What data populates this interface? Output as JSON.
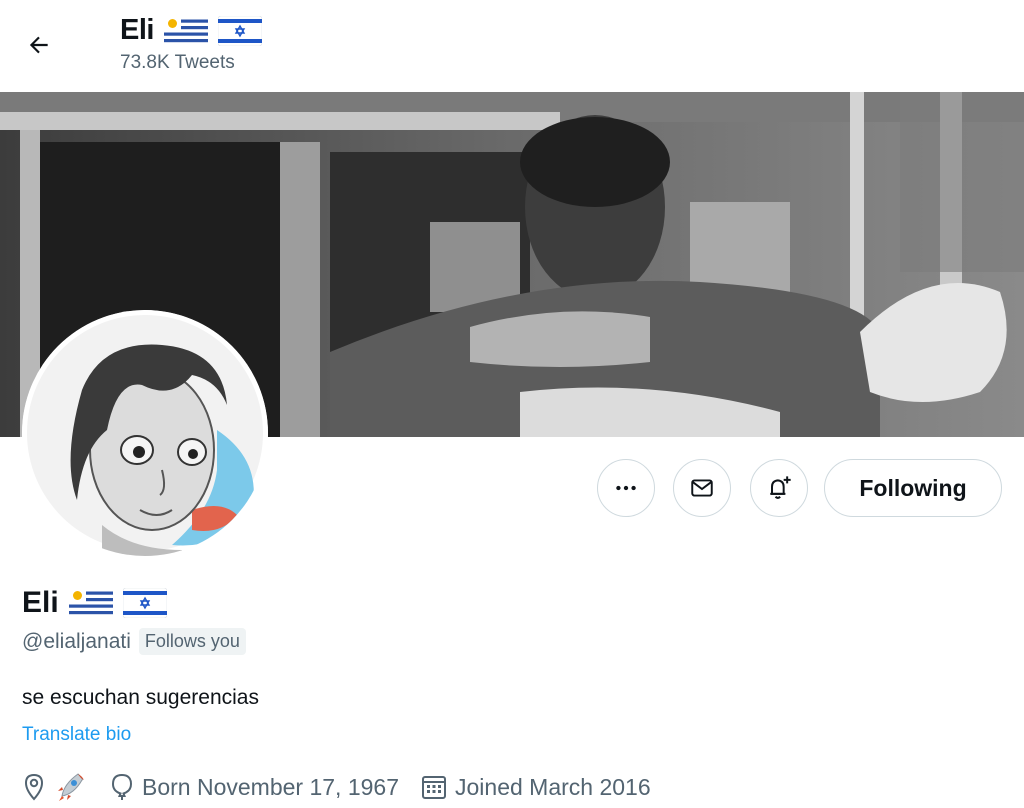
{
  "header": {
    "name": "Eli",
    "tweet_count": "73.8K Tweets"
  },
  "actions": {
    "following_label": "Following"
  },
  "profile": {
    "name": "Eli",
    "handle": "@elialjanati",
    "follows_you": "Follows you",
    "bio": "se escuchan sugerencias",
    "translate_label": "Translate bio",
    "location_emoji": "rocket",
    "birth": "Born November 17, 1967",
    "joined": "Joined March 2016"
  },
  "flags": [
    "uruguay-flag",
    "israel-flag"
  ],
  "colors": {
    "link": "#1d9bf0",
    "muted": "#536471",
    "border": "#cfd9de",
    "text": "#0f1419"
  },
  "icons": {
    "back": "arrow-left-icon",
    "more": "more-icon",
    "message": "envelope-icon",
    "notify": "bell-plus-icon",
    "location": "location-pin-icon",
    "birthday": "balloon-icon",
    "calendar": "calendar-icon"
  }
}
